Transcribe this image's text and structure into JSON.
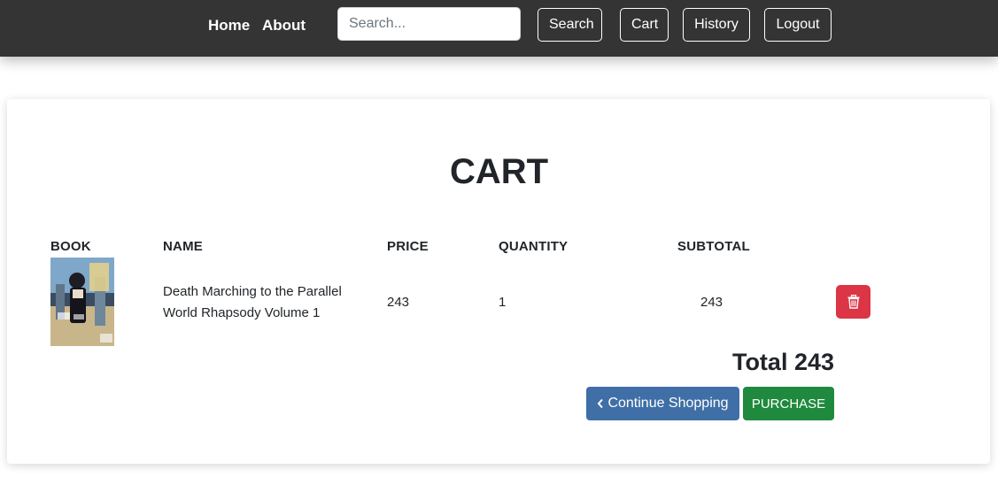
{
  "navbar": {
    "home_label": "Home",
    "about_label": "About",
    "search_placeholder": "Search...",
    "search_value": "",
    "search_button": "Search",
    "cart_button": "Cart",
    "history_button": "History",
    "logout_button": "Logout",
    "bg_color": "#343434"
  },
  "cart": {
    "title": "CART",
    "columns": [
      "BOOK",
      "NAME",
      "PRICE",
      "QUANTITY",
      "SUBTOTAL"
    ],
    "items": [
      {
        "name_line1": "Death Marching to the Parallel",
        "name_line2": "World Rhapsody Volume 1",
        "price": "243",
        "quantity": "1",
        "subtotal": "243",
        "delete_icon": "trash-icon"
      }
    ],
    "total_label": "Total 243",
    "continue_icon": "chevron-left-icon",
    "continue_label": "Continue Shopping",
    "purchase_label": "PURCHASE"
  },
  "colors": {
    "delete": "#dc3545",
    "continue": "#3f6fa6",
    "purchase": "#1f8a3e"
  }
}
